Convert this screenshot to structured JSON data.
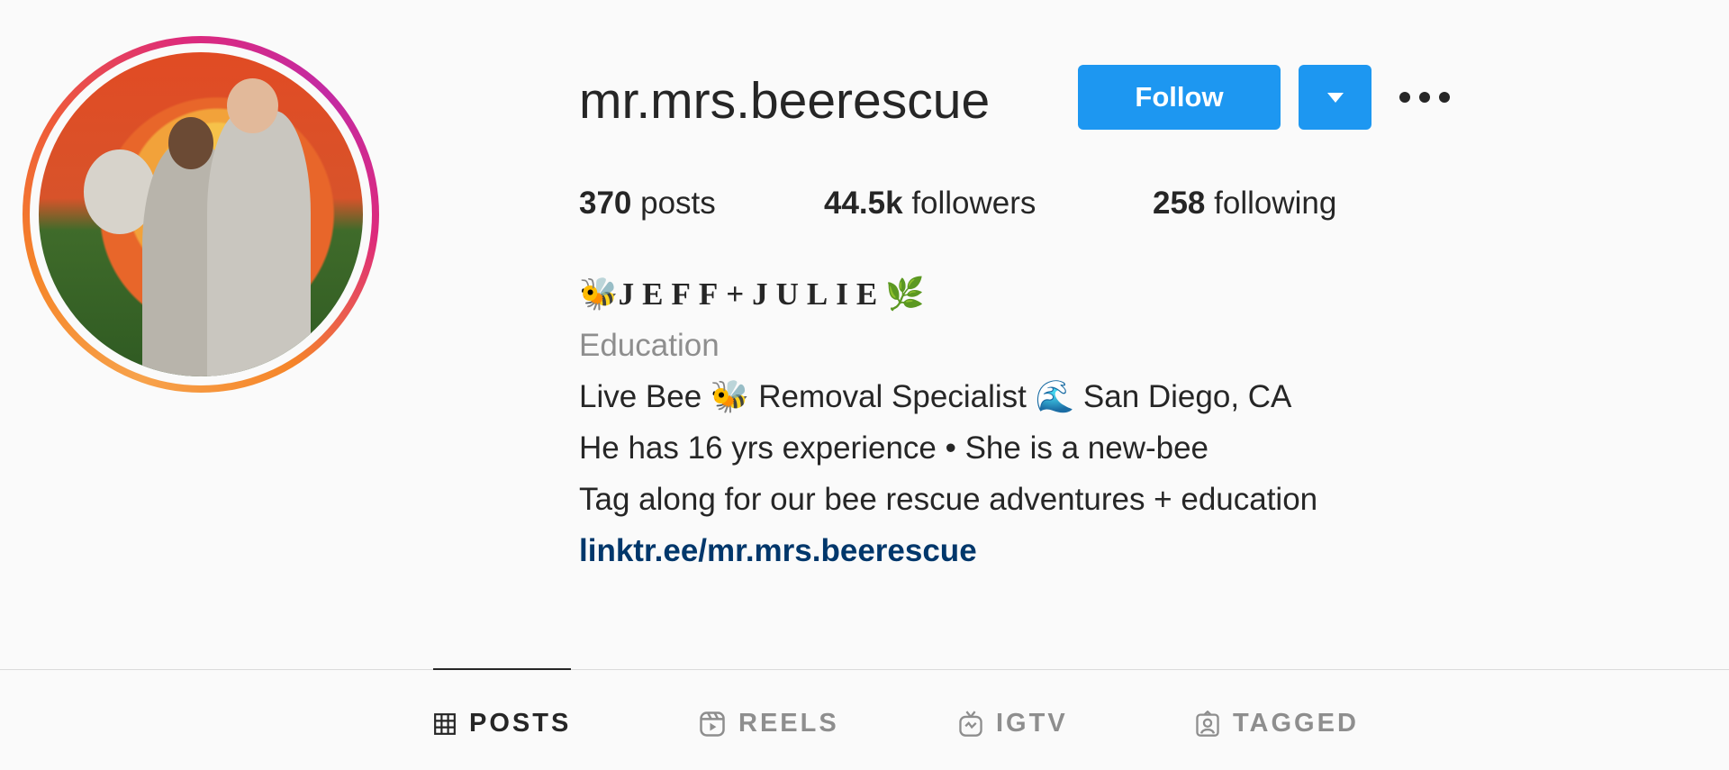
{
  "profile": {
    "username": "mr.mrs.beerescue",
    "follow_label": "Follow",
    "stats": {
      "posts_count": "370",
      "posts_label": " posts",
      "followers_count": "44.5k",
      "followers_label": " followers",
      "following_count": "258",
      "following_label": " following"
    },
    "bio": {
      "name_prefix": "🐝",
      "name": "JEFF+JULIE",
      "name_suffix": "🌿",
      "category": "Education",
      "line1": "Live Bee 🐝 Removal Specialist 🌊 San Diego, CA",
      "line2": "He has 16 yrs experience • She is a new-bee",
      "line3": "Tag along for our bee rescue adventures + education",
      "link": "linktr.ee/mr.mrs.beerescue"
    }
  },
  "tabs": [
    {
      "label": "POSTS",
      "icon": "grid-icon",
      "active": true
    },
    {
      "label": "REELS",
      "icon": "reels-icon",
      "active": false
    },
    {
      "label": "IGTV",
      "icon": "igtv-icon",
      "active": false
    },
    {
      "label": "TAGGED",
      "icon": "tagged-icon",
      "active": false
    }
  ],
  "colors": {
    "accent": "#1d97f1",
    "link": "#00376b",
    "muted": "#8e8e8e",
    "text": "#262626",
    "background": "#fafafa"
  }
}
